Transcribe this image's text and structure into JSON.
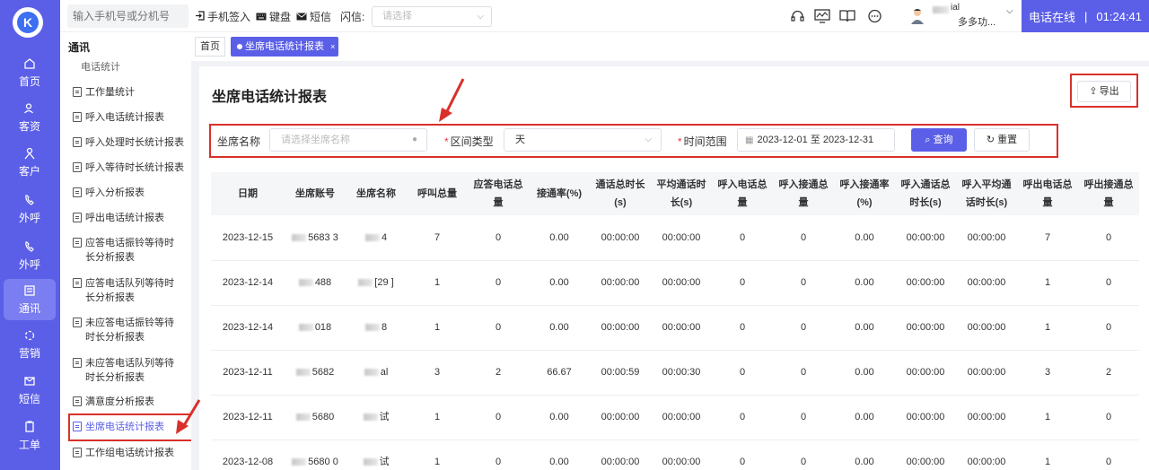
{
  "topbar": {
    "phone_placeholder": "输入手机号或分机号",
    "sign_in": "手机签入",
    "keyboard": "键盘",
    "sms": "短信",
    "flash_label": "闪信:",
    "flash_placeholder": "请选择",
    "user_name_line1": "ial",
    "user_name_line2": "多多功...",
    "status": "电话在线",
    "timer": "01:24:41"
  },
  "rail": {
    "items": [
      {
        "label": "首页",
        "icon": "home-icon"
      },
      {
        "label": "客资",
        "icon": "user-group-icon"
      },
      {
        "label": "客户",
        "icon": "customer-icon"
      },
      {
        "label": "外呼",
        "icon": "outbound-call-icon"
      },
      {
        "label": "外呼",
        "icon": "outbound-call-2-icon"
      },
      {
        "label": "通讯",
        "icon": "communication-icon"
      },
      {
        "label": "营销",
        "icon": "marketing-icon"
      },
      {
        "label": "短信",
        "icon": "sms-icon"
      },
      {
        "label": "工单",
        "icon": "ticket-icon"
      }
    ]
  },
  "subhead": {
    "module_title": "通讯",
    "tab_home": "首页",
    "tab_active": "坐席电话统计报表"
  },
  "sidebar": {
    "group": "电话统计",
    "items": [
      "工作量统计",
      "呼入电话统计报表",
      "呼入处理时长统计报表",
      "呼入等待时长统计报表",
      "呼入分析报表",
      "呼出电话统计报表",
      "应答电话振铃等待时长分析报表",
      "应答电话队列等待时长分析报表",
      "未应答电话振铃等待时长分析报表",
      "未应答电话队列等待时长分析报表",
      "满意度分析报表",
      "坐席电话统计报表",
      "工作组电话统计报表"
    ]
  },
  "main": {
    "title": "坐席电话统计报表",
    "export": "导出",
    "filter": {
      "agent_label": "坐席名称",
      "agent_placeholder": "请选择坐席名称",
      "interval_label": "区间类型",
      "interval_value": "天",
      "range_label": "时间范围",
      "range_value": "2023-12-01 至 2023-12-31",
      "query": "查询",
      "reset": "重置"
    }
  },
  "table": {
    "headers": [
      "日期",
      "坐席账号",
      "坐席名称",
      "呼叫总量",
      "应答电话总量",
      "接通率(%)",
      "通话总时长(s)",
      "平均通话时长(s)",
      "呼入电话总量",
      "呼入接通总量",
      "呼入接通率(%)",
      "呼入通话总时长(s)",
      "呼入平均通话时长(s)",
      "呼出电话总量",
      "呼出接通总量"
    ],
    "rows": [
      [
        "2023-12-15",
        "5683 3",
        "4",
        "7",
        "0",
        "0.00",
        "00:00:00",
        "00:00:00",
        "0",
        "0",
        "0.00",
        "00:00:00",
        "00:00:00",
        "7",
        "0"
      ],
      [
        "2023-12-14",
        "488",
        "[29 ]",
        "1",
        "0",
        "0.00",
        "00:00:00",
        "00:00:00",
        "0",
        "0",
        "0.00",
        "00:00:00",
        "00:00:00",
        "1",
        "0"
      ],
      [
        "2023-12-14",
        "018",
        "8",
        "1",
        "0",
        "0.00",
        "00:00:00",
        "00:00:00",
        "0",
        "0",
        "0.00",
        "00:00:00",
        "00:00:00",
        "1",
        "0"
      ],
      [
        "2023-12-11",
        "5682",
        "al",
        "3",
        "2",
        "66.67",
        "00:00:59",
        "00:00:30",
        "0",
        "0",
        "0.00",
        "00:00:00",
        "00:00:00",
        "3",
        "2"
      ],
      [
        "2023-12-11",
        "5680",
        "试",
        "1",
        "0",
        "0.00",
        "00:00:00",
        "00:00:00",
        "0",
        "0",
        "0.00",
        "00:00:00",
        "00:00:00",
        "1",
        "0"
      ],
      [
        "2023-12-08",
        "5680 0",
        "试",
        "1",
        "0",
        "0.00",
        "00:00:00",
        "00:00:00",
        "0",
        "0",
        "0.00",
        "00:00:00",
        "00:00:00",
        "1",
        "0"
      ]
    ]
  },
  "colors": {
    "brand": "#5b5fe7",
    "annotation": "#d9302a"
  }
}
